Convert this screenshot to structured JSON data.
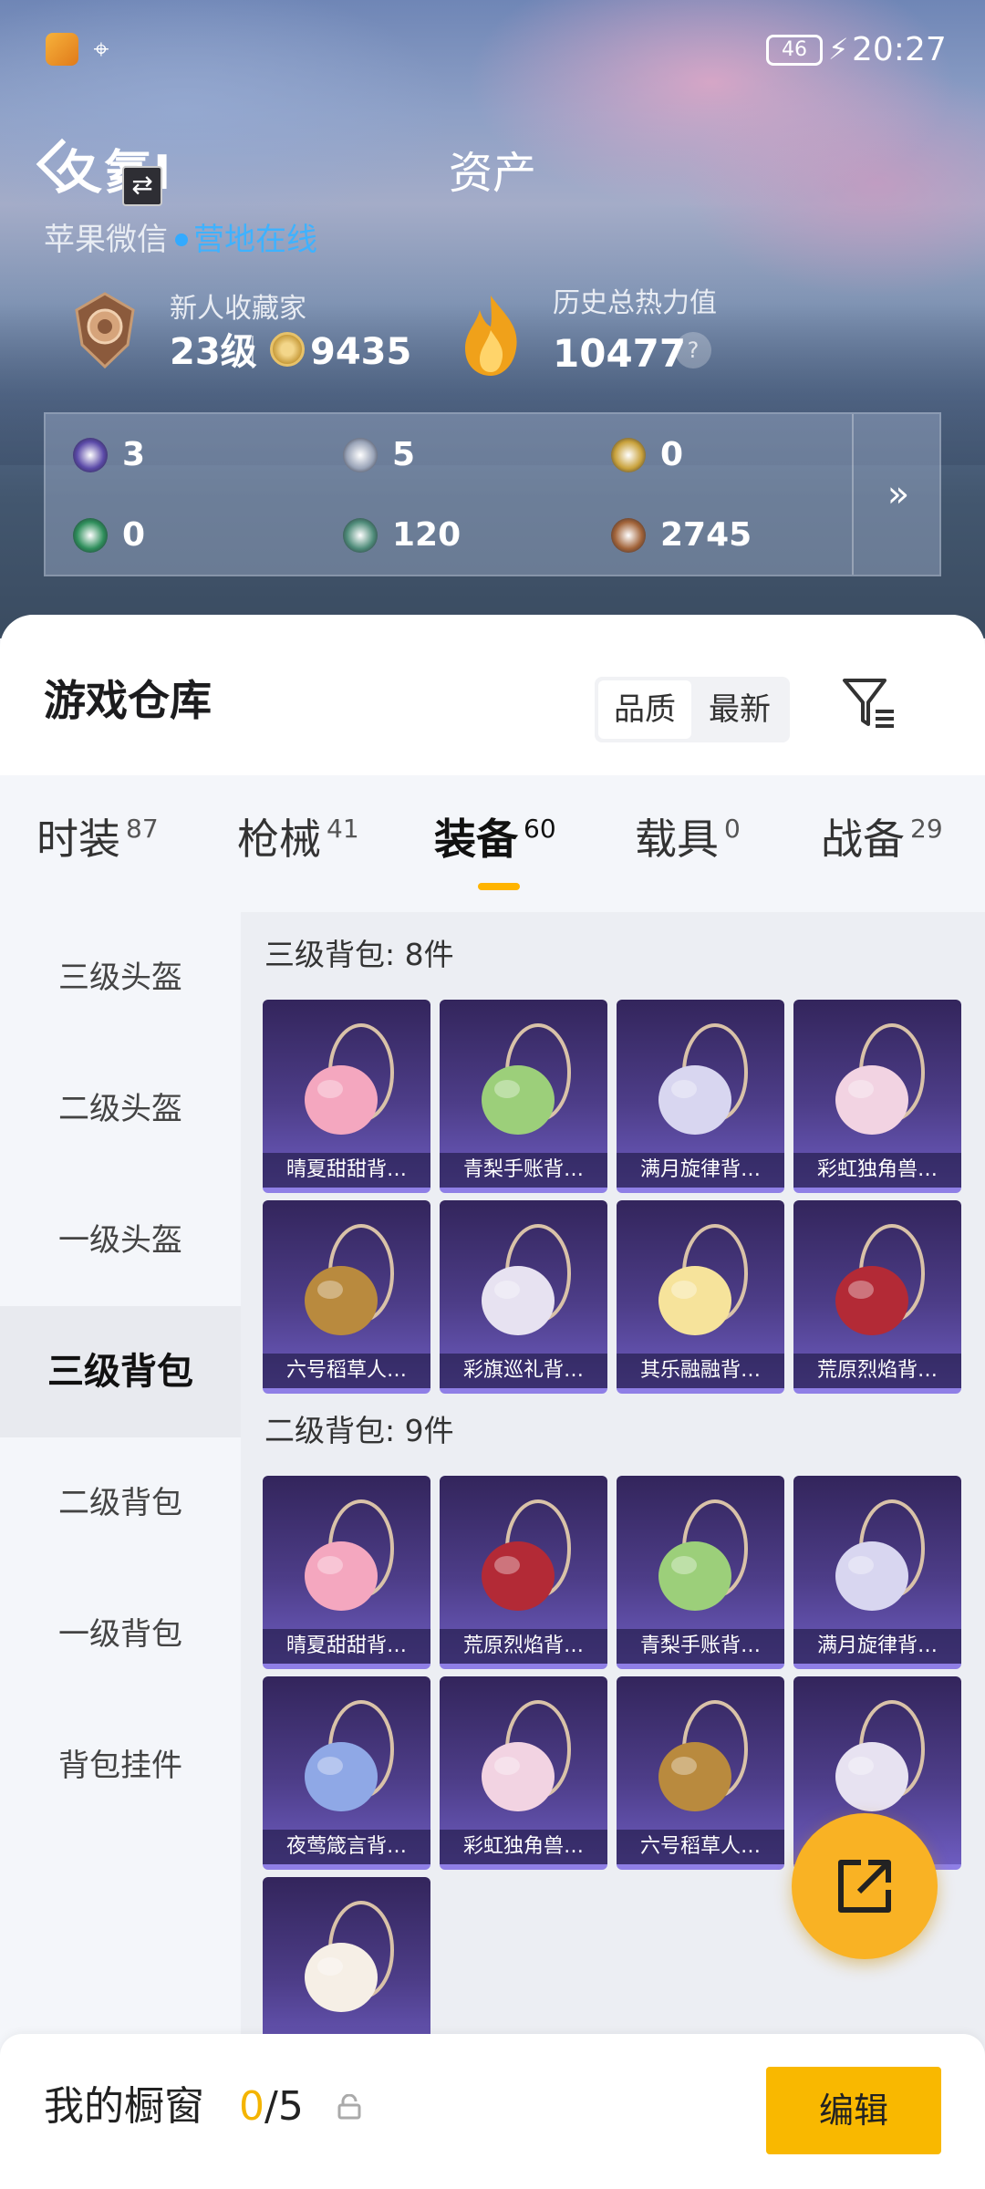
{
  "status_bar": {
    "battery": "46",
    "time": "20:27"
  },
  "header": {
    "title": "资产",
    "nickname": "夂氦I",
    "platform": "苹果微信",
    "online_status": "营地在线",
    "rank_title": "新人收藏家",
    "rank_level": "23级",
    "coins": "9435",
    "heat_title": "历史总热力值",
    "heat_value": "10477",
    "help_label": "?",
    "more_label": "»"
  },
  "resources": [
    {
      "icon": "purple-card-icon",
      "value": "3",
      "color": "#5b4aa8"
    },
    {
      "icon": "silver-badge-icon",
      "value": "5",
      "color": "#9aa4b8"
    },
    {
      "icon": "gold-badge-icon",
      "value": "0",
      "color": "#c9a23c"
    },
    {
      "icon": "green-card-icon",
      "value": "0",
      "color": "#2f8f5c"
    },
    {
      "icon": "teal-orb-icon",
      "value": "120",
      "color": "#4f8c7a"
    },
    {
      "icon": "bronze-coin-icon",
      "value": "2745",
      "color": "#a2643a"
    }
  ],
  "warehouse": {
    "title": "游戏仓库",
    "sort_options": [
      "品质",
      "最新"
    ],
    "active_sort": "品质"
  },
  "tabs": [
    {
      "label": "时装",
      "count": "87"
    },
    {
      "label": "枪械",
      "count": "41"
    },
    {
      "label": "装备",
      "count": "60",
      "active": true
    },
    {
      "label": "载具",
      "count": "0"
    },
    {
      "label": "战备",
      "count": "29"
    }
  ],
  "sidebar": [
    {
      "label": "三级头盔"
    },
    {
      "label": "二级头盔"
    },
    {
      "label": "一级头盔"
    },
    {
      "label": "三级背包",
      "active": true
    },
    {
      "label": "二级背包"
    },
    {
      "label": "一级背包"
    },
    {
      "label": "背包挂件"
    }
  ],
  "sections": [
    {
      "title": "三级背包: 8件",
      "items": [
        {
          "name": "晴夏甜甜背…",
          "color": "#f4a7bf"
        },
        {
          "name": "青梨手账背…",
          "color": "#9ccf7a"
        },
        {
          "name": "满月旋律背…",
          "color": "#d8d6f0"
        },
        {
          "name": "彩虹独角兽…",
          "color": "#f2d3e2"
        },
        {
          "name": "六号稻草人…",
          "color": "#b98a3e"
        },
        {
          "name": "彩旗巡礼背…",
          "color": "#e7e2f1"
        },
        {
          "name": "其乐融融背…",
          "color": "#f6e39b"
        },
        {
          "name": "荒原烈焰背…",
          "color": "#b32a36"
        }
      ]
    },
    {
      "title": "二级背包: 9件",
      "items": [
        {
          "name": "晴夏甜甜背…",
          "color": "#f4a7bf"
        },
        {
          "name": "荒原烈焰背…",
          "color": "#b32a36"
        },
        {
          "name": "青梨手账背…",
          "color": "#9ccf7a"
        },
        {
          "name": "满月旋律背…",
          "color": "#d8d6f0"
        },
        {
          "name": "夜莺箴言背…",
          "color": "#8fa8e6"
        },
        {
          "name": "彩虹独角兽…",
          "color": "#f2d3e2"
        },
        {
          "name": "六号稻草人…",
          "color": "#b98a3e"
        },
        {
          "name": "",
          "color": "#e7e2f1"
        },
        {
          "name": "",
          "color": "#f6efe6"
        }
      ]
    }
  ],
  "bottom": {
    "showcase_label": "我的橱窗",
    "showcase_used": "0",
    "showcase_total": "/5",
    "edit_label": "编辑"
  }
}
